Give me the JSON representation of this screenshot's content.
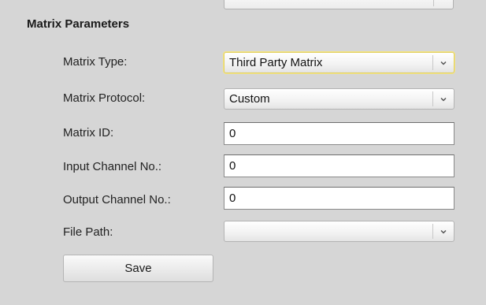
{
  "section": {
    "title": "Matrix Parameters"
  },
  "fields": {
    "matrix_type": {
      "label": "Matrix Type:",
      "value": "Third Party Matrix"
    },
    "matrix_protocol": {
      "label": "Matrix Protocol:",
      "value": "Custom"
    },
    "matrix_id": {
      "label": "Matrix ID:",
      "value": "0"
    },
    "input_channel": {
      "label": "Input Channel No.:",
      "value": "0"
    },
    "output_channel": {
      "label": "Output Channel No.:",
      "value": "0"
    },
    "file_path": {
      "label": "File Path:",
      "value": ""
    }
  },
  "actions": {
    "save_label": "Save"
  },
  "icons": {
    "dropdown": "chevron-down-icon"
  },
  "colors": {
    "background": "#d6d6d6",
    "focus_border": "#e2cf5c"
  }
}
